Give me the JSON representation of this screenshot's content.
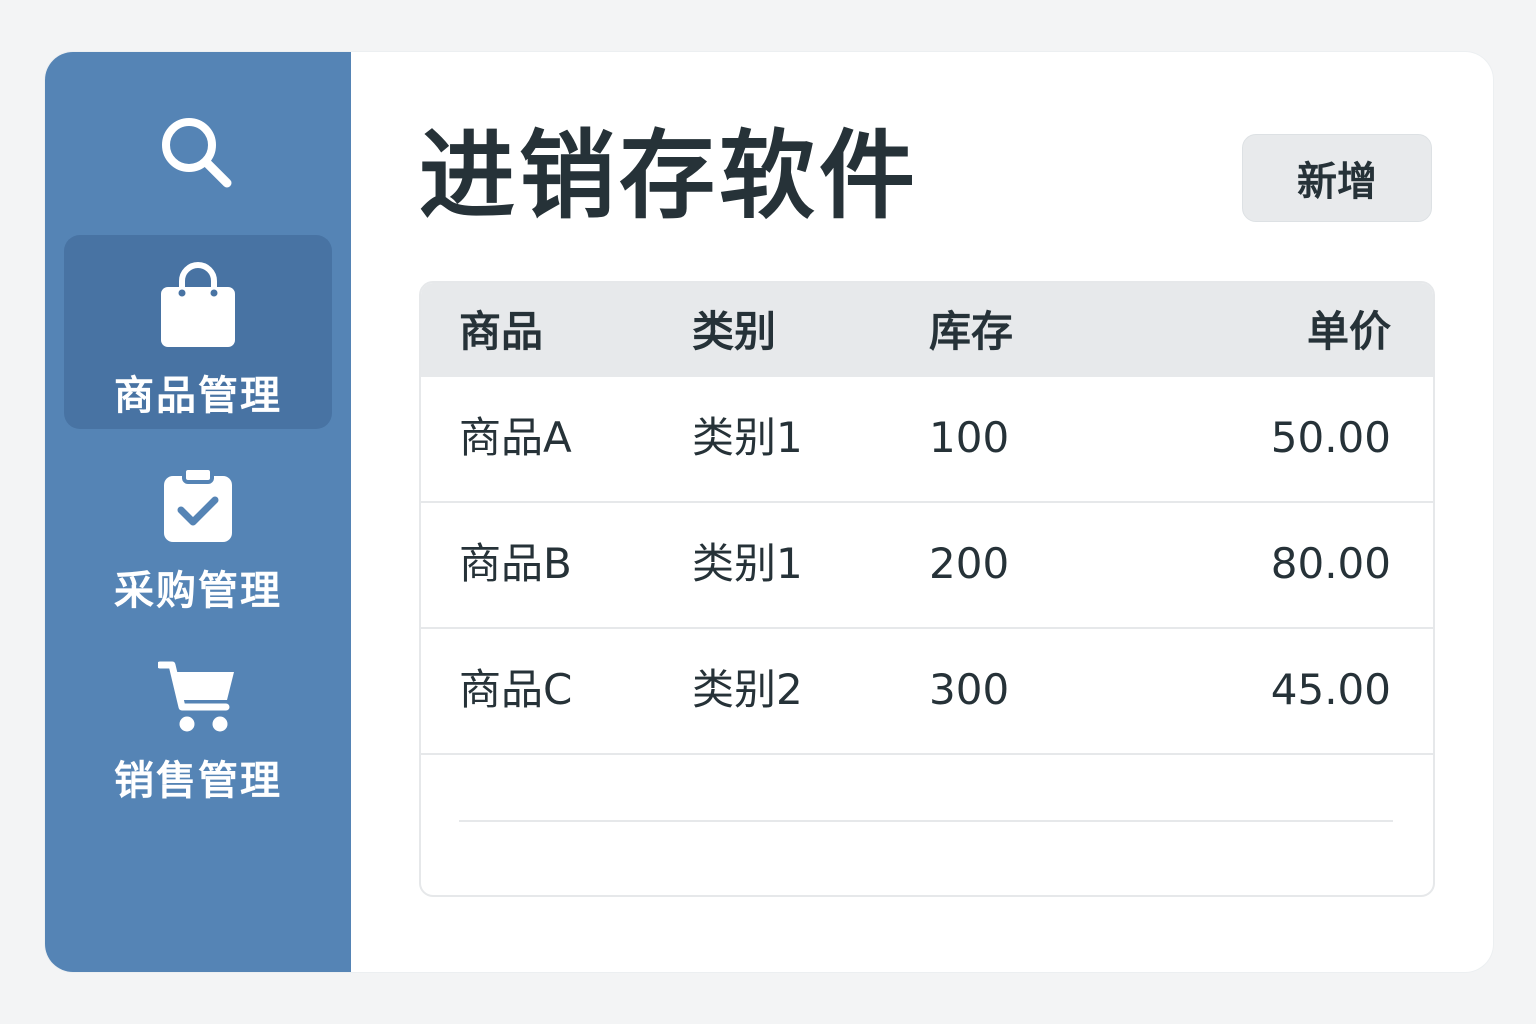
{
  "app": {
    "title": "进销存软件",
    "add_button": "新增"
  },
  "sidebar": {
    "search_icon": "search-icon",
    "items": [
      {
        "label": "商品管理",
        "icon": "shopping-bag-icon",
        "active": true
      },
      {
        "label": "采购管理",
        "icon": "clipboard-check-icon",
        "active": false
      },
      {
        "label": "销售管理",
        "icon": "shopping-cart-icon",
        "active": false
      }
    ]
  },
  "table": {
    "headers": [
      "商品",
      "类别",
      "库存",
      "单价"
    ],
    "rows": [
      [
        "商品A",
        "类别1",
        "100",
        "50.00"
      ],
      [
        "商品B",
        "类别1",
        "200",
        "80.00"
      ],
      [
        "商品C",
        "类别2",
        "300",
        "45.00"
      ]
    ]
  },
  "colors": {
    "sidebar": "#5584b5",
    "sidebar_active": "#4873a3",
    "text": "#263238",
    "header_bg": "#e7e9eb"
  }
}
